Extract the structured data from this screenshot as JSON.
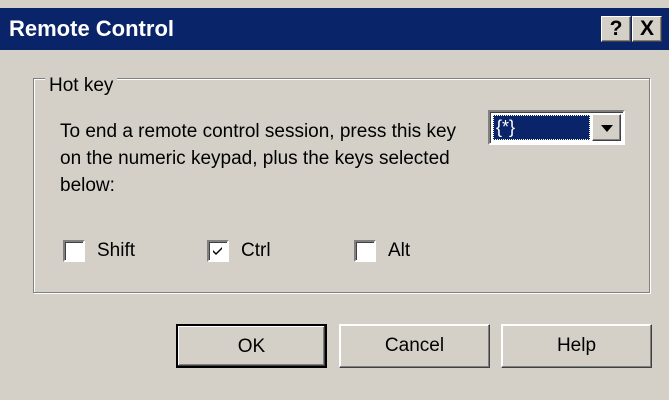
{
  "window": {
    "title": "Remote Control",
    "help_button": "?",
    "close_button": "X"
  },
  "hotkey_group": {
    "label": "Hot key",
    "description": "To end a remote control session, press this key on the numeric keypad, plus the keys selected below:",
    "key_select": {
      "selected": "{*}"
    },
    "modifiers": [
      {
        "label": "Shift",
        "checked": false
      },
      {
        "label": "Ctrl",
        "checked": true
      },
      {
        "label": "Alt",
        "checked": false
      }
    ]
  },
  "buttons": {
    "ok": "OK",
    "cancel": "Cancel",
    "help": "Help"
  },
  "colors": {
    "titlebar": "#0a246a",
    "dialog_bg": "#d4d0c8",
    "selection": "#0a246a"
  },
  "icons": {
    "combo_arrow": "chevron-down-icon",
    "check_mark": "checkmark-icon"
  }
}
